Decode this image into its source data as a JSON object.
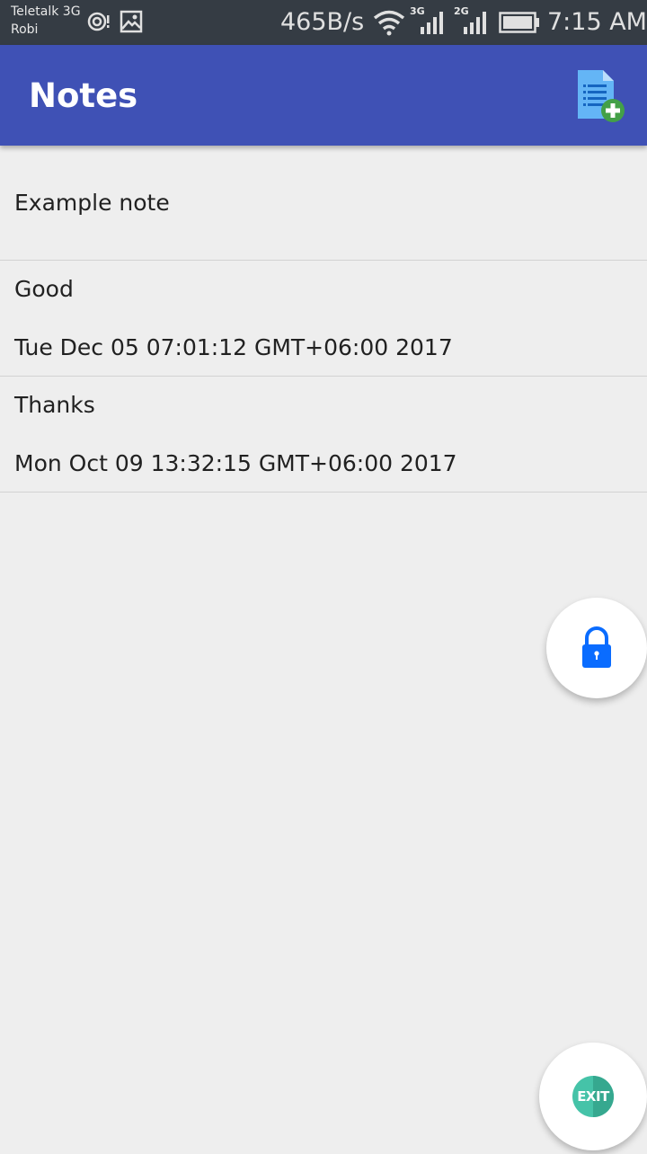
{
  "status_bar": {
    "carrier_1": "Teletalk 3G",
    "carrier_2": "Robi",
    "speed": "465B/s",
    "net_1": "3G",
    "net_2": "2G",
    "time": "7:15 AM",
    "icons": [
      "hotspot-icon",
      "image-icon",
      "wifi-icon",
      "signal-icon",
      "signal-icon",
      "battery-icon"
    ]
  },
  "app_bar": {
    "title": "Notes",
    "add_icon": "add-note-icon",
    "color": "#3f51b5"
  },
  "notes": [
    {
      "title": "Example note",
      "date": ""
    },
    {
      "title": "Good",
      "date": "Tue Dec 05 07:01:12 GMT+06:00 2017"
    },
    {
      "title": "Thanks",
      "date": "Mon Oct 09 13:32:15 GMT+06:00 2017"
    }
  ],
  "fabs": {
    "lock_icon": "lock-icon",
    "exit_icon": "exit-icon",
    "exit_label": "EXIT",
    "lock_color": "#0a6cff",
    "exit_color": "#45c3a8"
  }
}
